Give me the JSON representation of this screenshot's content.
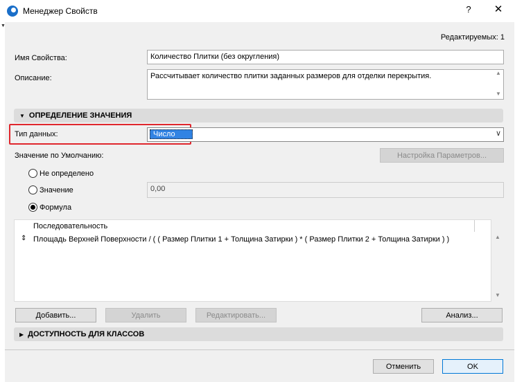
{
  "window": {
    "title": "Менеджер Свойств",
    "help_glyph": "?",
    "close_glyph": "✕"
  },
  "edit_count": "Редактируемых: 1",
  "property_name": {
    "label": "Имя Свойства:",
    "value": "Количество Плитки (без округления)"
  },
  "description": {
    "label": "Описание:",
    "value": "Рассчитывает количество плитки заданных размеров для отделки перекрытия."
  },
  "section_value_definition": {
    "title": "ОПРЕДЕЛЕНИЕ ЗНАЧЕНИЯ",
    "triangle": "▼"
  },
  "data_type": {
    "label": "Тип данных:",
    "value": "Число",
    "dropdown_glyph": "∨"
  },
  "default_value": {
    "label": "Значение по Умолчанию:",
    "settings_button": "Настройка Параметров..."
  },
  "radios": [
    {
      "label": "Не определено",
      "checked": false
    },
    {
      "label": "Значение",
      "checked": false
    },
    {
      "label": "Формула",
      "checked": true
    }
  ],
  "value_field": "0,00",
  "formula": {
    "header": "Последовательность",
    "row_icon": "⇕",
    "row": "Площадь Верхней Поверхности / ( ( Размер Плитки 1 + Толщина Затирки ) * ( Размер Плитки 2 + Толщина Затирки ) )"
  },
  "buttons": {
    "add": "Добавить...",
    "remove": "Удалить",
    "edit": "Редактировать...",
    "analyze": "Анализ...",
    "cancel": "Отменить",
    "ok": "OK"
  },
  "section_class_availability": {
    "title": "ДОСТУПНОСТЬ ДЛЯ КЛАССОВ",
    "triangle": "▶"
  },
  "colors": {
    "selection": "#3183e3",
    "highlight_border": "#e0262d"
  }
}
